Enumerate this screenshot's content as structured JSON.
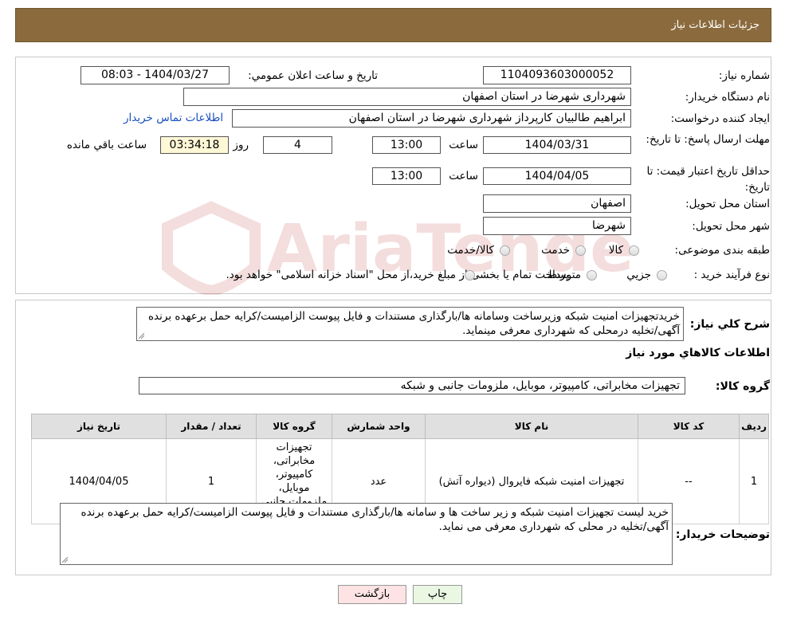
{
  "header": {
    "title": "جزئیات اطلاعات نیاز"
  },
  "form": {
    "need_number": {
      "label": "شماره نياز:",
      "value": "1104093603000052"
    },
    "announce_datetime": {
      "label": "تاريخ و ساعت اعلان عمومي:",
      "value": "1404/03/27 - 08:03"
    },
    "buyer_org": {
      "label": "نام دستگاه خريدار:",
      "value": "شهرداری شهرضا در استان اصفهان"
    },
    "requester": {
      "label": "ايجاد کننده درخواست:",
      "value": "ابراهیم طالبیان کارپرداز شهرداری شهرضا در استان اصفهان",
      "contact_link": "اطلاعات تماس خريدار"
    },
    "deadline": {
      "label": "مهلت ارسال پاسخ: تا تاريخ:",
      "date": "1404/03/31",
      "time_label": "ساعت",
      "time": "13:00",
      "days": "4",
      "days_label": "روز و",
      "remaining": "03:34:18",
      "remaining_label": "ساعت باقي مانده"
    },
    "price_validity": {
      "label": "حداقل تاريخ اعتبار قيمت: تا تاريخ:",
      "date": "1404/04/05",
      "time_label": "ساعت",
      "time": "13:00"
    },
    "province": {
      "label": "استان محل تحويل:",
      "value": "اصفهان"
    },
    "city": {
      "label": "شهر محل تحويل:",
      "value": "شهرضا"
    },
    "category": {
      "label": "طبقه بندی موضوعی:",
      "options": [
        "کالا",
        "خدمت",
        "کالا/خدمت"
      ]
    },
    "process": {
      "label": "نوع فرآيند خريد :",
      "options": [
        "جزيي",
        "متوسط"
      ],
      "note": "پرداخت تمام یا بخشی از مبلغ خرید،از محل \"اسناد خزانه اسلامی\" خواهد بود."
    }
  },
  "description": {
    "label": "شرح کلي نياز:",
    "text": "خریدتجهیزات امنیت شبکه وزیرساخت وسامانه ها/بارگذاری مستندات و فایل پیوست الزامیست/کرایه حمل برعهده برنده آگهی/تخلیه درمحلی که شهرداری معرفی مینماید."
  },
  "goods_section": {
    "title": "اطلاعات کالاهاي مورد نياز"
  },
  "goods_group": {
    "label": "گروه کالا:",
    "value": "تجهیزات مخابراتی، کامپیوتر، موبایل، ملزومات جانبی و شبکه"
  },
  "table": {
    "headers": [
      "رديف",
      "کد کالا",
      "نام کالا",
      "واحد شمارش",
      "گروه کالا",
      "تعداد / مقدار",
      "تاريخ نياز"
    ],
    "rows": [
      [
        "1",
        "--",
        "تجهیزات امنیت شبکه فایروال (دیواره آتش)",
        "عدد",
        "تجهیزات مخابراتی، کامپیوتر، موبایل، ملزومات جانبی و شبکه",
        "1",
        "1404/04/05"
      ]
    ]
  },
  "buyer_notes": {
    "label": "توضيحات خريدار:",
    "text": "خرید لیست تجهیزات امنیت شبکه و زیر ساخت ها و سامانه ها/بارگذاری مستندات و فایل پیوست الزامیست/کرایه حمل برعهده برنده آگهی/تخلیه در محلی که شهرداری معرفی می نماید."
  },
  "buttons": {
    "print": "چاپ",
    "back": "بازگشت"
  },
  "watermark": {
    "text": "AriaTender.neT"
  },
  "colors": {
    "header_bg": "#8B6B3D",
    "link": "#1a4fbf",
    "timer_bg": "#fff8d6",
    "back_button_bg": "#fde3e3",
    "print_button_bg": "#e9f7e3"
  }
}
